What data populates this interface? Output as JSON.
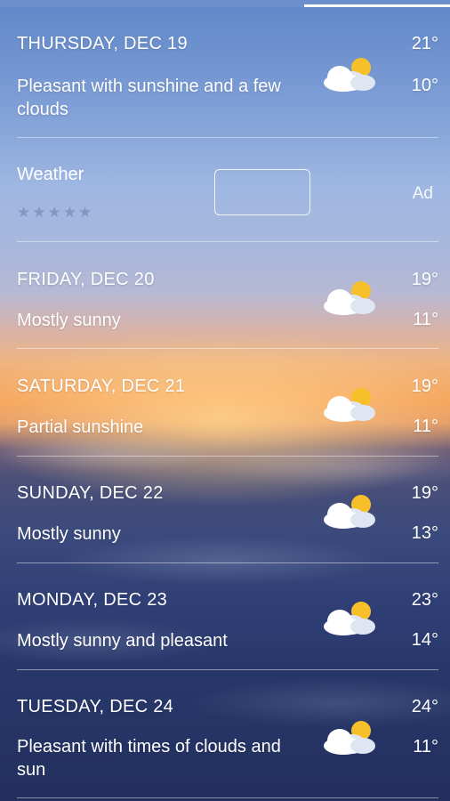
{
  "forecast": [
    {
      "day": "THURSDAY, DEC 19",
      "desc": "Pleasant with sunshine and a few clouds",
      "hi": "21°",
      "lo": "10°",
      "icon": "partly-cloudy-icon"
    },
    {
      "day": "FRIDAY, DEC 20",
      "desc": "Mostly sunny",
      "hi": "19°",
      "lo": "11°",
      "icon": "partly-cloudy-icon"
    },
    {
      "day": "SATURDAY, DEC 21",
      "desc": "Partial sunshine",
      "hi": "19°",
      "lo": "11°",
      "icon": "partly-cloudy-icon"
    },
    {
      "day": "SUNDAY, DEC 22",
      "desc": "Mostly sunny",
      "hi": "19°",
      "lo": "13°",
      "icon": "partly-cloudy-icon"
    },
    {
      "day": "MONDAY, DEC 23",
      "desc": "Mostly sunny and pleasant",
      "hi": "23°",
      "lo": "14°",
      "icon": "partly-cloudy-icon"
    },
    {
      "day": "TUESDAY, DEC 24",
      "desc": "Pleasant with times of clouds and sun",
      "hi": "24°",
      "lo": "11°",
      "icon": "partly-cloudy-icon"
    }
  ],
  "ad": {
    "title": "Weather",
    "rating_stars": "★★★★★",
    "label": "Ad"
  },
  "colors": {
    "sun": "#f7c02a",
    "cloud": "#ffffff",
    "cloud_shade": "#dfe6f2"
  }
}
